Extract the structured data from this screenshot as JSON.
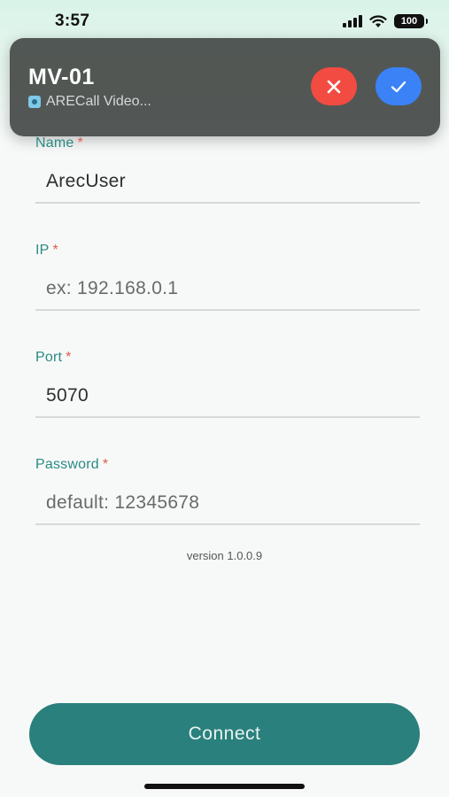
{
  "status_bar": {
    "time": "3:57",
    "battery": "100",
    "icons": [
      "cellular-signal-icon",
      "wifi-icon",
      "battery-icon"
    ]
  },
  "call_banner": {
    "caller": "MV-01",
    "subtitle": "ARECall Video...",
    "app_icon": "arecall-app-icon",
    "decline_icon": "close-icon",
    "accept_icon": "checkmark-icon",
    "decline_color": "#f24b41",
    "accept_color": "#3b82f6"
  },
  "form": {
    "required_marker": "*",
    "fields": [
      {
        "label": "Name",
        "value": "ArecUser",
        "placeholder": ""
      },
      {
        "label": "IP",
        "value": "",
        "placeholder": "ex: 192.168.0.1"
      },
      {
        "label": "Port",
        "value": "5070",
        "placeholder": ""
      },
      {
        "label": "Password",
        "value": "",
        "placeholder": "default: 12345678"
      }
    ]
  },
  "version": "version 1.0.0.9",
  "connect_button": {
    "label": "Connect",
    "color": "#2a807c"
  }
}
